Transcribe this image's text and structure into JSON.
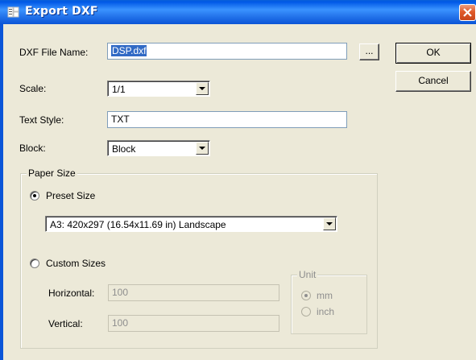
{
  "window": {
    "title": "Export DXF",
    "icon": "dxf-export-icon",
    "close_icon": "close-icon"
  },
  "fields": {
    "file_name": {
      "label": "DXF File Name:",
      "value": "DSP.dxf",
      "browse_label": "..."
    },
    "scale": {
      "label": "Scale:",
      "value": "1/1"
    },
    "text_style": {
      "label": "Text Style:",
      "value": "TXT"
    },
    "block": {
      "label": "Block:",
      "value": "Block"
    }
  },
  "buttons": {
    "ok": "OK",
    "cancel": "Cancel"
  },
  "paper_size": {
    "title": "Paper Size",
    "preset": {
      "label": "Preset Size",
      "checked": true,
      "value": "A3: 420x297 (16.54x11.69 in) Landscape"
    },
    "custom": {
      "label": "Custom Sizes",
      "checked": false,
      "horizontal_label": "Horizontal:",
      "horizontal_value": "100",
      "vertical_label": "Vertical:",
      "vertical_value": "100"
    },
    "unit": {
      "title": "Unit",
      "mm_label": "mm",
      "mm_checked": true,
      "inch_label": "inch",
      "inch_checked": false
    }
  },
  "colors": {
    "titlebar": "#0a5fd8",
    "dialog_bg": "#ece9d8",
    "selection": "#316ac5",
    "close_button": "#e05a2a"
  }
}
